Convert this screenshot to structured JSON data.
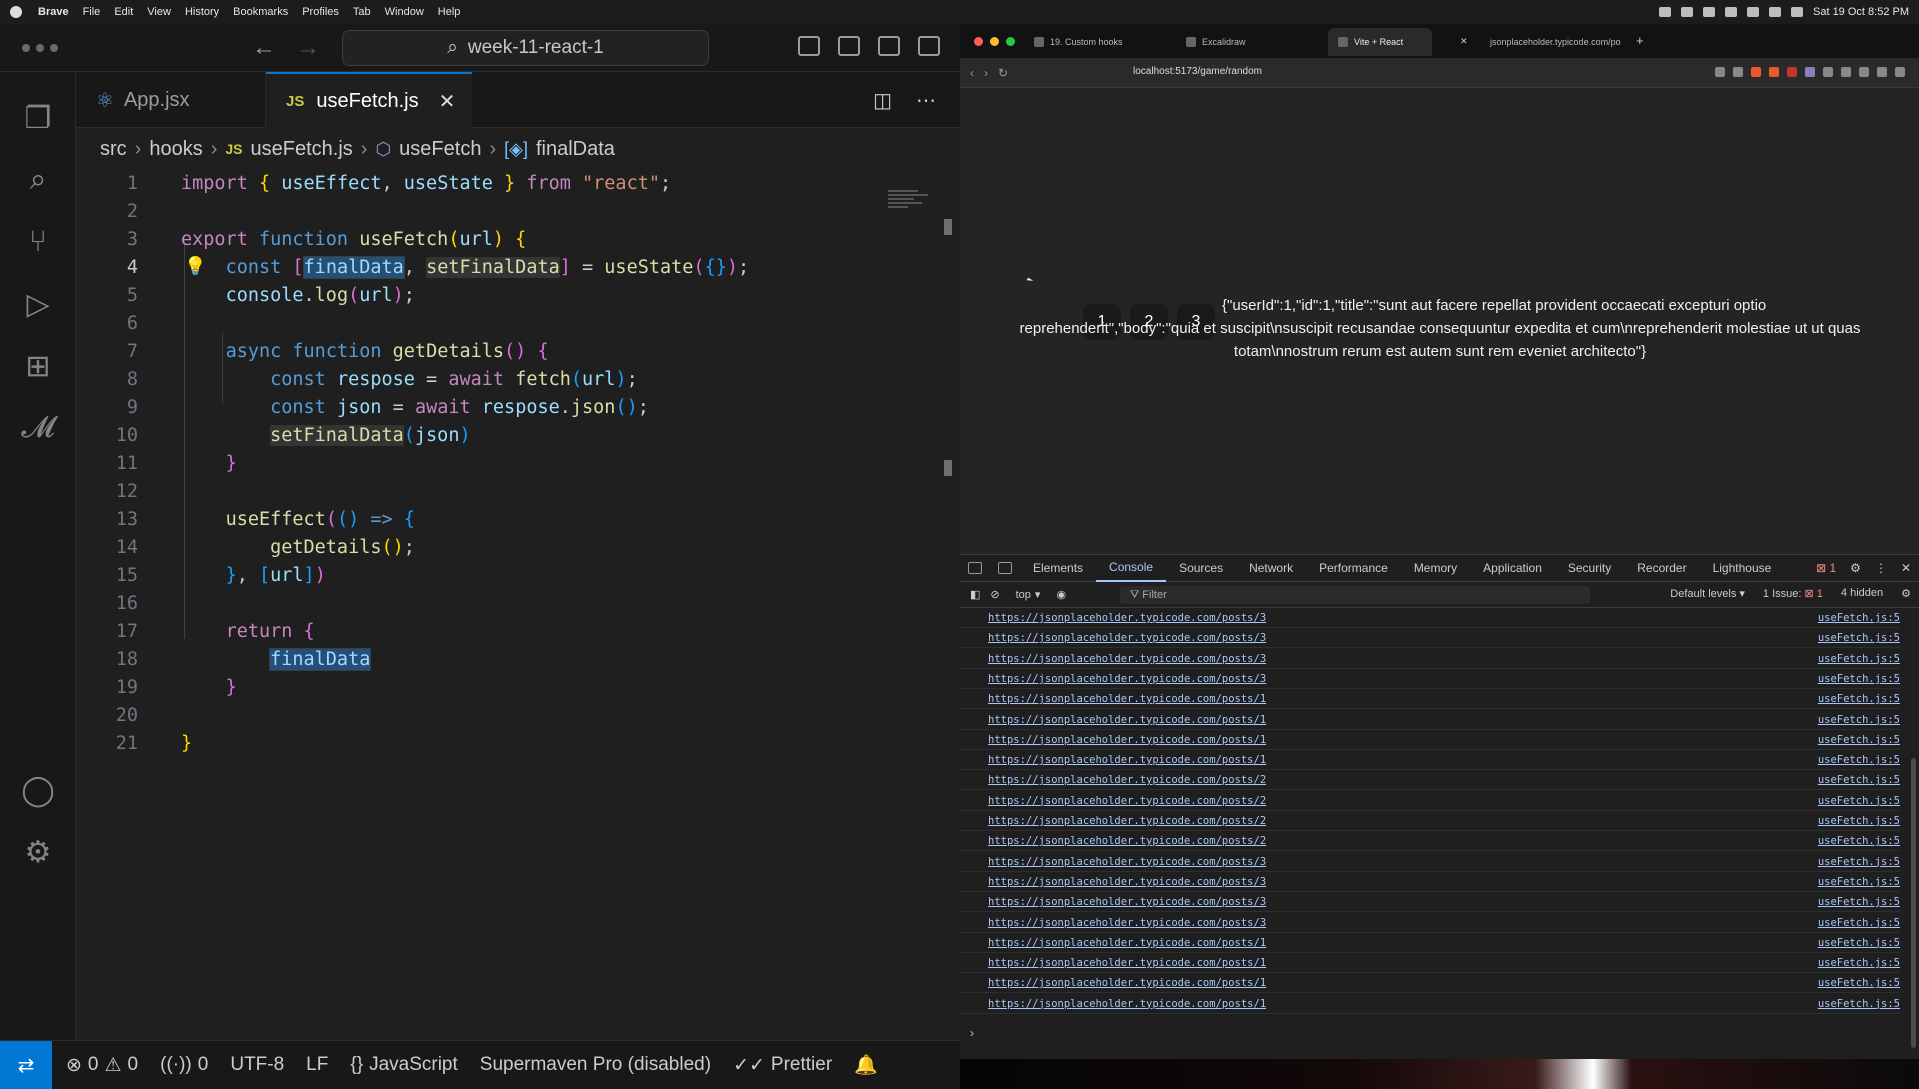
{
  "menubar": {
    "app": "Brave",
    "items": [
      "File",
      "Edit",
      "View",
      "History",
      "Bookmarks",
      "Profiles",
      "Tab",
      "Window",
      "Help"
    ],
    "datetime": "Sat 19 Oct  8:52 PM"
  },
  "vscode": {
    "search_text": "week-11-react-1",
    "tabs": [
      {
        "label": "App.jsx",
        "icon": "react-icon"
      },
      {
        "label": "useFetch.js",
        "icon": "js-icon"
      }
    ],
    "breadcrumb": [
      "src",
      "hooks",
      "useFetch.js",
      "useFetch",
      "finalData"
    ],
    "line_numbers": [
      "1",
      "2",
      "3",
      "4",
      "5",
      "6",
      "7",
      "8",
      "9",
      "10",
      "11",
      "12",
      "13",
      "14",
      "15",
      "16",
      "17",
      "18",
      "19",
      "20",
      "21"
    ],
    "status": {
      "errors": "0",
      "warnings": "0",
      "ports": "0",
      "encoding": "UTF-8",
      "eol": "LF",
      "language": "JavaScript",
      "supermaven": "Supermaven Pro (disabled)",
      "prettier": "Prettier"
    },
    "colors": {
      "accent": "#0078d4"
    }
  },
  "browser": {
    "tabs": [
      "19. Custom hooks",
      "Excalidraw",
      "Vite + React",
      "jsonplaceholder.typicode.com/po"
    ],
    "url": "localhost:5173/game/random",
    "buttons": [
      "1",
      "2",
      "3"
    ],
    "json_line1": "{\"userId\":1,\"id\":1,\"title\":\"sunt aut facere repellat provident occaecati excepturi optio",
    "json_line2": "reprehenderit\",\"body\":\"quia et suscipit\\nsuscipit recusandae consequuntur expedita et cum\\nreprehenderit molestiae ut ut quas",
    "json_line3": "totam\\nnostrum rerum est autem sunt rem eveniet architecto\"}"
  },
  "devtools": {
    "tabs": [
      "Elements",
      "Console",
      "Sources",
      "Network",
      "Performance",
      "Memory",
      "Application",
      "Security",
      "Recorder",
      "Lighthouse"
    ],
    "error_count": "1",
    "context": "top",
    "filter_placeholder": "Filter",
    "levels": "Default levels",
    "issues": "1 Issue:",
    "issues_count": "1",
    "hidden": "4 hidden",
    "log_source": "useFetch.js:5",
    "logs": [
      "https://jsonplaceholder.typicode.com/posts/3",
      "https://jsonplaceholder.typicode.com/posts/3",
      "https://jsonplaceholder.typicode.com/posts/3",
      "https://jsonplaceholder.typicode.com/posts/3",
      "https://jsonplaceholder.typicode.com/posts/1",
      "https://jsonplaceholder.typicode.com/posts/1",
      "https://jsonplaceholder.typicode.com/posts/1",
      "https://jsonplaceholder.typicode.com/posts/1",
      "https://jsonplaceholder.typicode.com/posts/2",
      "https://jsonplaceholder.typicode.com/posts/2",
      "https://jsonplaceholder.typicode.com/posts/2",
      "https://jsonplaceholder.typicode.com/posts/2",
      "https://jsonplaceholder.typicode.com/posts/3",
      "https://jsonplaceholder.typicode.com/posts/3",
      "https://jsonplaceholder.typicode.com/posts/3",
      "https://jsonplaceholder.typicode.com/posts/3",
      "https://jsonplaceholder.typicode.com/posts/1",
      "https://jsonplaceholder.typicode.com/posts/1",
      "https://jsonplaceholder.typicode.com/posts/1",
      "https://jsonplaceholder.typicode.com/posts/1"
    ]
  }
}
